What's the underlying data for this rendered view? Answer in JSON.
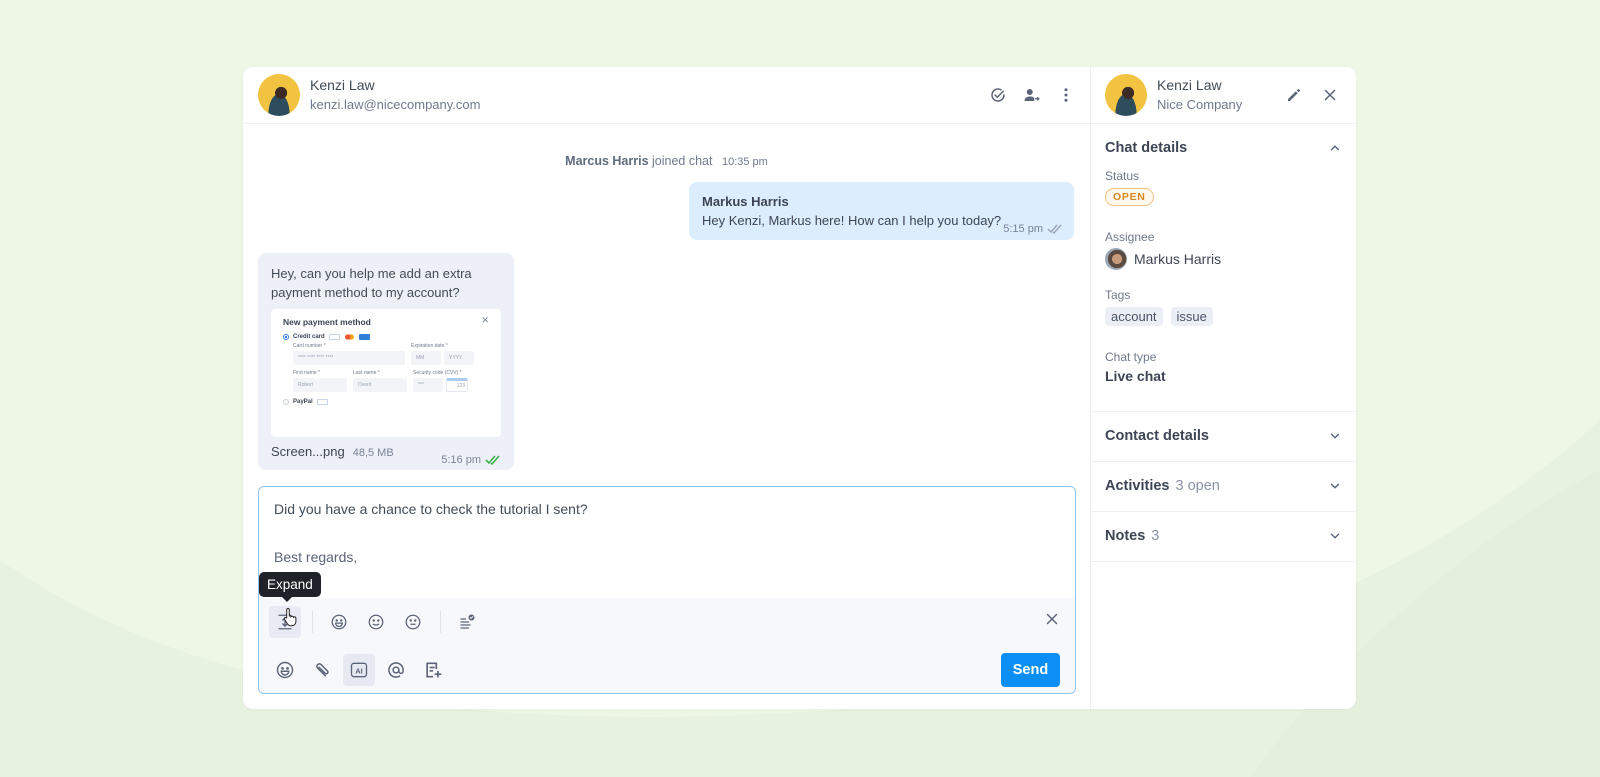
{
  "background": {
    "color": "#eef6e6"
  },
  "chat": {
    "header": {
      "name": "Kenzi Law",
      "email": "kenzi.law@nicecompany.com",
      "actions": [
        {
          "icon": "check-circle-icon",
          "label": "Resolve"
        },
        {
          "icon": "transfer-user-icon",
          "label": "Transfer"
        },
        {
          "icon": "more-vertical-icon",
          "label": "More"
        }
      ]
    },
    "system_message": {
      "actor": "Marcus Harris",
      "text": "joined chat",
      "time": "10:35 pm"
    },
    "messages": [
      {
        "direction": "outgoing",
        "author": "Markus Harris",
        "text": "Hey Kenzi, Markus here! How can I help you today?",
        "time": "5:15 pm",
        "status": "read"
      },
      {
        "direction": "incoming",
        "text": "Hey, can you help me add an extra payment method to my account?",
        "attachment": {
          "filename": "Screen...png",
          "size": "48,5 MB",
          "preview": {
            "title": "New payment method",
            "option_credit_card": "Credit card",
            "card_number_label": "Card number *",
            "card_number_placeholder": "**** **** **** ****",
            "expiration_label": "Expiration date *",
            "month_placeholder": "MM",
            "year_placeholder": "YYYY",
            "first_name_label": "First name *",
            "first_name_value": "Robert",
            "last_name_label": "Last name *",
            "last_name_value": "Overit",
            "security_label": "Security code (CVV) *",
            "security_placeholder": "***",
            "cvv_hint": "123",
            "option_paypal": "PayPal"
          }
        },
        "time": "5:16 pm",
        "status": "delivered"
      }
    ],
    "composer": {
      "line1": "Did you have a chance to check the tutorial I sent?",
      "line2": "Best regards,",
      "tooltip": "Expand",
      "format_tools": [
        "expand-icon",
        "emoji-grin-icon",
        "emoji-smile-icon",
        "emoji-neutral-icon",
        "list-check-icon"
      ],
      "action_tools": [
        "emoji-icon",
        "paperclip-icon",
        "ai-icon",
        "mention-icon",
        "canned-response-icon"
      ],
      "ai_label": "AI",
      "send_label": "Send"
    }
  },
  "details": {
    "header": {
      "name": "Kenzi Law",
      "company": "Nice Company"
    },
    "chat_details": {
      "title": "Chat details",
      "status_label": "Status",
      "status_value": "OPEN",
      "assignee_label": "Assignee",
      "assignee_value": "Markus Harris",
      "tags_label": "Tags",
      "tags": [
        "account",
        "issue"
      ],
      "chat_type_label": "Chat type",
      "chat_type_value": "Live chat"
    },
    "sections": [
      {
        "title": "Contact details",
        "sub": ""
      },
      {
        "title": "Activities",
        "sub": "3 open"
      },
      {
        "title": "Notes",
        "sub": "3"
      }
    ]
  }
}
